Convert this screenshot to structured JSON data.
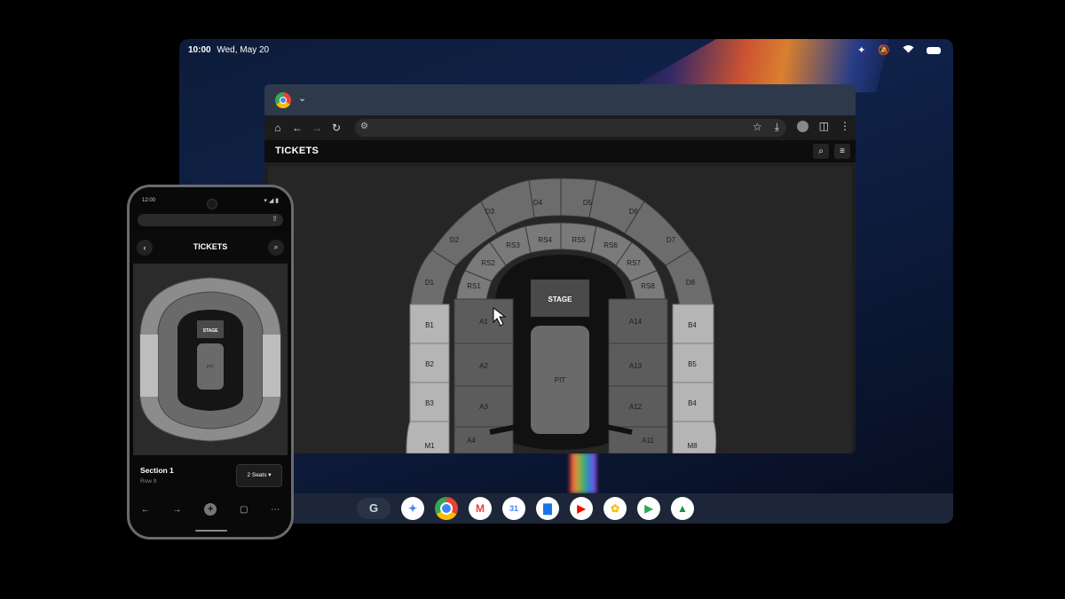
{
  "tablet": {
    "status": {
      "time": "10:00",
      "date": "Wed, May 20"
    },
    "status_icons": [
      "sparkle-icon",
      "bell-off-icon",
      "wifi-icon",
      "battery-icon"
    ]
  },
  "browser": {
    "toolbar_icons": [
      "home-icon",
      "back-icon",
      "forward-icon",
      "reload-icon",
      "site-settings-icon",
      "star-icon",
      "download-icon",
      "profile-icon",
      "reader-icon",
      "menu-icon"
    ],
    "site_title": "TICKETS",
    "stage_label": "STAGE",
    "pit_label": "PIT",
    "sections": {
      "D1": "D1",
      "D2": "D2",
      "D3": "D3",
      "D4": "D4",
      "D5": "D5",
      "D6": "D6",
      "D7": "D7",
      "D8": "D8",
      "RS1": "RS1",
      "RS2": "RS2",
      "RS3": "RS3",
      "RS4": "RS4",
      "RS5": "RS5",
      "RS6": "RS6",
      "RS7": "RS7",
      "RS8": "RS8",
      "B1": "B1",
      "B2": "B2",
      "B3": "B3",
      "B4a": "B4",
      "B5": "B5",
      "B4b": "B4",
      "A1": "A1",
      "A2": "A2",
      "A3": "A3",
      "A4": "A4",
      "A14": "A14",
      "A13": "A13",
      "A12": "A12",
      "A11": "A11",
      "M1": "M1",
      "M8": "M8"
    }
  },
  "dock": {
    "launcher": "G",
    "apps": [
      "gemini-icon",
      "chrome-icon",
      "gmail-icon",
      "calendar-icon",
      "files-icon",
      "youtube-icon",
      "photos-icon",
      "play-store-icon",
      "drive-icon"
    ],
    "calendar_day": "31",
    "app_colors": [
      "#4285f4",
      "#ea4335",
      "#fbbc05",
      "#34a853"
    ]
  },
  "phone": {
    "time": "12:00",
    "title": "TICKETS",
    "stage_label": "STAGE",
    "pit_label": "PIT",
    "section_title": "Section 1",
    "row": "Row 9",
    "seats_label": "2 Seats"
  }
}
